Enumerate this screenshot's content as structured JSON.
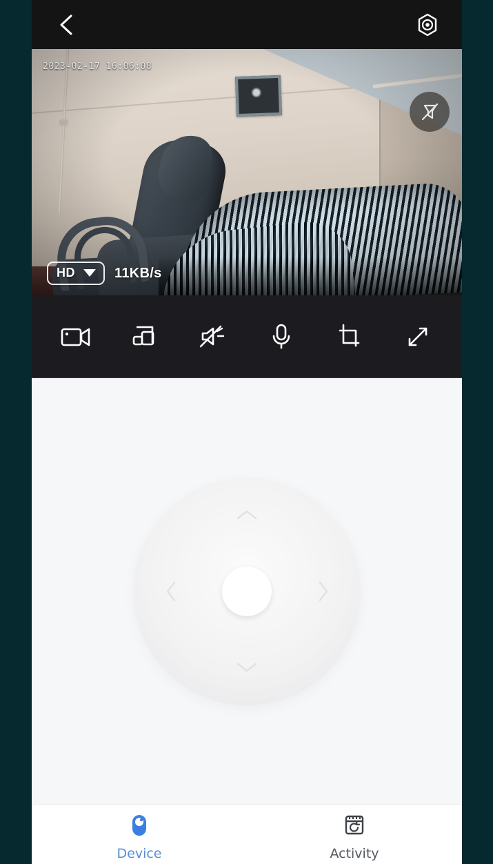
{
  "app": {
    "background_color": "#05292e",
    "accent_color": "#3d7fe0"
  },
  "header": {
    "back_icon": "chevron-left-icon",
    "settings_icon": "hexagon-settings-icon"
  },
  "video": {
    "timestamp": "2023-02-17 16:06:08",
    "alarm_icon": "siren-muted-icon",
    "quality": {
      "label": "HD",
      "caret_icon": "caret-down-icon"
    },
    "bitrate": "11KB/s",
    "scene_description": "Indoor room view from security camera: beige wall, office chair at left, zebra-striped bedding at right, framed picture on wall"
  },
  "toolbar": {
    "items": [
      {
        "name": "record-video",
        "icon": "video-camera-icon"
      },
      {
        "name": "multi-screen",
        "icon": "multi-screen-icon"
      },
      {
        "name": "speaker-mute",
        "icon": "speaker-muted-icon"
      },
      {
        "name": "microphone",
        "icon": "microphone-icon"
      },
      {
        "name": "snapshot-crop",
        "icon": "crop-icon"
      },
      {
        "name": "fullscreen",
        "icon": "expand-arrows-icon"
      }
    ]
  },
  "ptz": {
    "up_icon": "chevron-up-icon",
    "down_icon": "chevron-down-icon",
    "left_icon": "chevron-left-icon",
    "right_icon": "chevron-right-icon",
    "center_icon": "ptz-center-button"
  },
  "bottom_nav": {
    "items": [
      {
        "label": "Device",
        "icon": "device-camera-icon",
        "active": true
      },
      {
        "label": "Activity",
        "icon": "calendar-history-icon",
        "active": false
      }
    ]
  }
}
